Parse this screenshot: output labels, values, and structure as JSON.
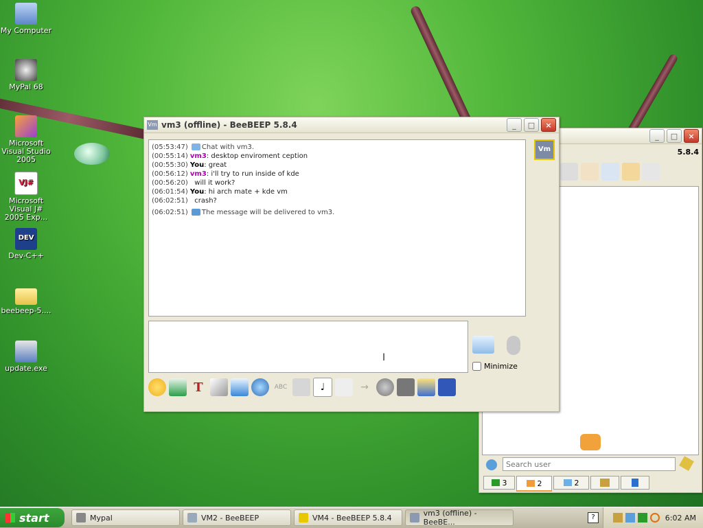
{
  "desktop": {
    "icons": [
      {
        "label": "My Computer"
      },
      {
        "label": "MyPal 68"
      },
      {
        "label": "Microsoft Visual Studio 2005"
      },
      {
        "label": "Microsoft Visual J# 2005 Exp..."
      },
      {
        "label": "Dev-C++"
      },
      {
        "label": "beebeep-5...."
      },
      {
        "label": "update.exe"
      }
    ]
  },
  "chat_window": {
    "title": "vm3 (offline) - BeeBEEP 5.8.4",
    "title_icon": "Vm",
    "avatar": "Vm",
    "messages": [
      {
        "time": "(05:53:47)",
        "user": "",
        "text": "Chat with vm3.",
        "icon": "chat-icon"
      },
      {
        "time": "(00:55:14)",
        "user": "vm3",
        "text": ": desktop enviroment ception"
      },
      {
        "time": "(00:55:30)",
        "user": "You",
        "text": ": great"
      },
      {
        "time": "(00:56:12)",
        "user": "vm3",
        "text": ": i'll try to run inside of kde"
      },
      {
        "time": "(00:56:20)",
        "user": "",
        "text": "will it work?"
      },
      {
        "time": "(06:01:54)",
        "user": "You",
        "text": ": hi arch mate + kde vm"
      },
      {
        "time": "(06:02:51)",
        "user": "",
        "text": "crash?"
      },
      {
        "time": "(06:02:51)",
        "user": "",
        "text": "The message will be delivered to vm3.",
        "icon": "mail-icon"
      }
    ],
    "minimize_label": "Minimize",
    "toolbar": [
      "smiley-icon",
      "receive-icon",
      "text-color-icon",
      "brush-icon",
      "filter-icon",
      "gear-icon",
      "spellcheck-icon",
      "font-icon",
      "music-icon",
      "file-icon",
      "forward-icon",
      "globe-icon",
      "terminal-icon",
      "notes-icon",
      "save-icon"
    ]
  },
  "main_window": {
    "version": "5.8.4",
    "search_placeholder": "Search user",
    "tabs": [
      {
        "label": "3"
      },
      {
        "label": "2"
      },
      {
        "label": "2"
      },
      {
        "label": ""
      },
      {
        "label": ""
      }
    ]
  },
  "taskbar": {
    "start": "start",
    "tasks": [
      {
        "label": "Mypal"
      },
      {
        "label": "VM2 - BeeBEEP"
      },
      {
        "label": "VM4 - BeeBEEP 5.8.4"
      },
      {
        "label": "vm3 (offline) - BeeBE..."
      }
    ],
    "clock": "6:02 AM"
  }
}
